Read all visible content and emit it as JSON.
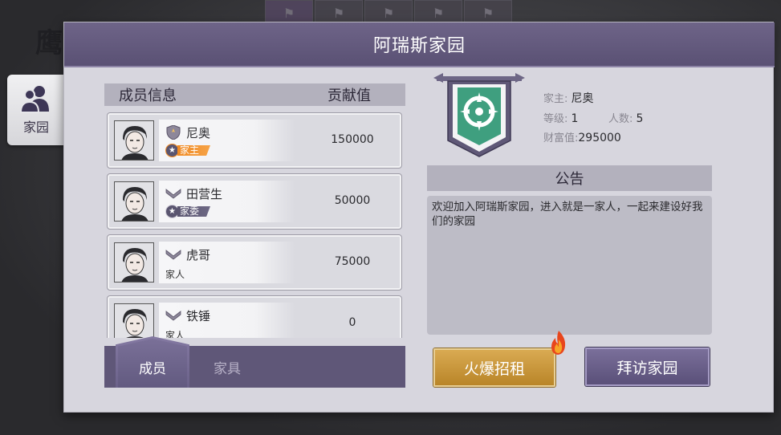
{
  "background": {
    "hawk_text": "鹰",
    "top_tiles": [
      "map-icon",
      "map-icon",
      "map-icon",
      "map-icon",
      "map-icon"
    ]
  },
  "side_tab": {
    "label": "家园",
    "icon": "people-icon"
  },
  "panel": {
    "title": "阿瑞斯家园"
  },
  "member_list": {
    "header_member": "成员信息",
    "header_contribution": "贡献值",
    "members": [
      {
        "name": "尼奥",
        "role": "家主",
        "role_style": "owner",
        "contribution": "150000",
        "rank_icon": "rank-shield-icon"
      },
      {
        "name": "田营生",
        "role": "家委",
        "role_style": "committee",
        "contribution": "50000",
        "rank_icon": "rank-chevron-icon"
      },
      {
        "name": "虎哥",
        "role": "家人",
        "role_style": "plain",
        "contribution": "75000",
        "rank_icon": "rank-chevron-icon"
      },
      {
        "name": "铁锤",
        "role": "家人",
        "role_style": "plain",
        "contribution": "0",
        "rank_icon": "rank-chevron-icon"
      }
    ]
  },
  "bottom_tabs": {
    "members": "成员",
    "furniture": "家具"
  },
  "home_info": {
    "owner_label": "家主:",
    "owner_value": "尼奥",
    "level_label": "等级:",
    "level_value": "1",
    "people_label": "人数:",
    "people_value": "5",
    "wealth_label": "财富值:",
    "wealth_value": "295000",
    "emblem_icon": "crosshair-banner-icon"
  },
  "notice": {
    "title": "公告",
    "text": "欢迎加入阿瑞斯家园，进入就是一家人，一起来建设好我们的家园"
  },
  "buttons": {
    "recruit": "火爆招租",
    "visit": "拜访家园"
  },
  "colors": {
    "header": "#5f5678",
    "panel": "#d7d6de",
    "owner_badge": "#f08a24",
    "committee_badge": "#5a5570",
    "gold_button": "#c99338",
    "purple_button": "#675d88"
  }
}
